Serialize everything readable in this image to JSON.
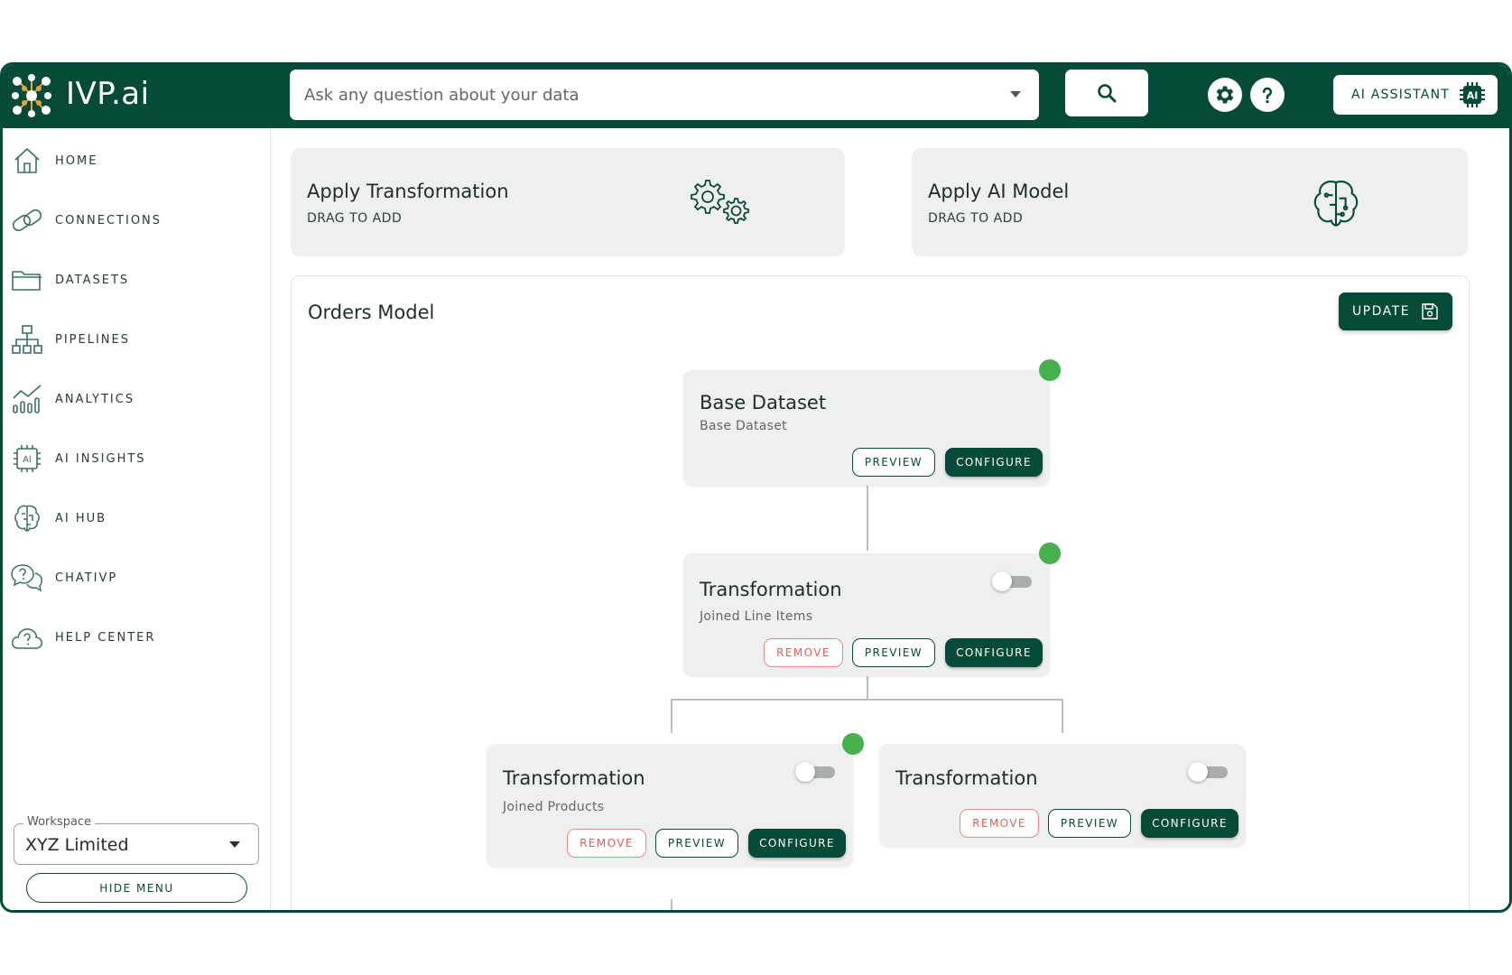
{
  "app": {
    "brand": "IVP.ai"
  },
  "header": {
    "search_placeholder": "Ask any question about your data",
    "ai_assistant_label": "AI ASSISTANT",
    "ai_badge": "AI"
  },
  "sidebar": {
    "items": [
      {
        "label": "HOME",
        "icon": "home-icon"
      },
      {
        "label": "CONNECTIONS",
        "icon": "link-icon"
      },
      {
        "label": "DATASETS",
        "icon": "folder-icon"
      },
      {
        "label": "PIPELINES",
        "icon": "hierarchy-icon"
      },
      {
        "label": "ANALYTICS",
        "icon": "analytics-icon"
      },
      {
        "label": "AI INSIGHTS",
        "icon": "ai-chip-icon"
      },
      {
        "label": "AI HUB",
        "icon": "brain-icon"
      },
      {
        "label": "CHATIVP",
        "icon": "chat-help-icon"
      },
      {
        "label": "HELP CENTER",
        "icon": "cloud-help-icon"
      }
    ],
    "workspace_label": "Workspace",
    "workspace_value": "XYZ Limited",
    "hide_menu_label": "HIDE MENU"
  },
  "tools": {
    "transformation": {
      "title": "Apply Transformation",
      "subtitle": "DRAG TO ADD"
    },
    "ai_model": {
      "title": "Apply AI Model",
      "subtitle": "DRAG TO ADD"
    }
  },
  "model": {
    "title": "Orders Model",
    "update_label": "UPDATE",
    "nodes": [
      {
        "title": "Base Dataset",
        "subtitle": "Base Dataset",
        "preview": "PREVIEW",
        "configure": "CONFIGURE"
      },
      {
        "title": "Transformation",
        "subtitle": "Joined Line Items",
        "remove": "REMOVE",
        "preview": "PREVIEW",
        "configure": "CONFIGURE"
      },
      {
        "title": "Transformation",
        "subtitle": "Joined Products",
        "remove": "REMOVE",
        "preview": "PREVIEW",
        "configure": "CONFIGURE"
      },
      {
        "title": "Transformation",
        "remove": "REMOVE",
        "preview": "PREVIEW",
        "configure": "CONFIGURE"
      }
    ]
  },
  "colors": {
    "brand": "#064a3a",
    "status_ok": "#45b04c",
    "danger": "#e0615b",
    "card_bg": "#eef0ef"
  }
}
